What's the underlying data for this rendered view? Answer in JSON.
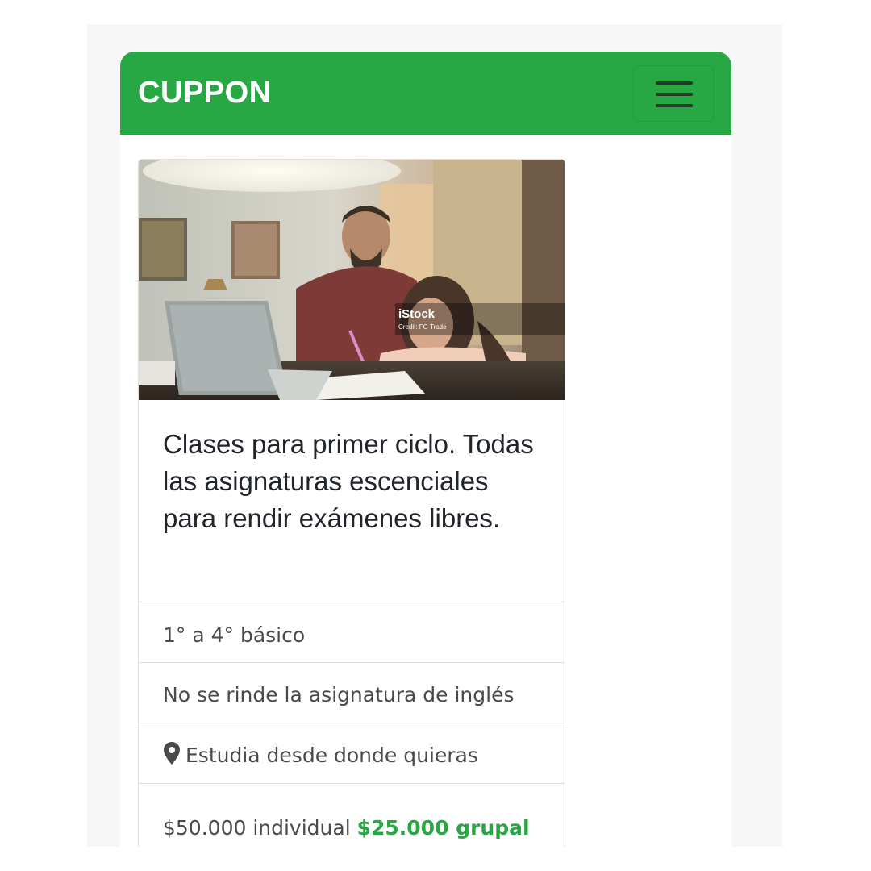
{
  "navbar": {
    "brand": "CUPPON",
    "menu_icon": "hamburger-icon",
    "color": "#28a745"
  },
  "card": {
    "image": {
      "watermark_brand": "iStock",
      "watermark_credit": "Credit: FG Trade"
    },
    "title": "Clases para primer ciclo. Todas las asignaturas escenciales para rendir exámenes libres.",
    "list": {
      "level": "1° a 4° básico",
      "note": "No se rinde la asignatura de inglés",
      "location": "Estudia desde donde quieras",
      "location_icon": "map-marker-icon",
      "price_individual": "$50.000 individual",
      "price_group": "$25.000 grupal"
    },
    "accent": "#28a745"
  }
}
